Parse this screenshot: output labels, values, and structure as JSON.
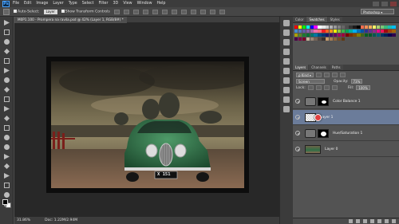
{
  "app": {
    "logo": "Ps"
  },
  "menu": [
    "File",
    "Edit",
    "Image",
    "Layer",
    "Type",
    "Select",
    "Filter",
    "3D",
    "View",
    "Window",
    "Help"
  ],
  "options_bar": {
    "auto_select_label": "Auto-Select:",
    "auto_select_value": "Layer",
    "show_transform_label": "Show Transform Controls",
    "workspace": "Photoshop ▾"
  },
  "document": {
    "tab_title": "M0P1.100 - Prompera na ravila.psd @ 42% (Layer 1, RGB/8#) *",
    "zoom": "31.86%",
    "doc_size": "Doc: 1.22M/2.94M",
    "plate_text": "X 151"
  },
  "panels": {
    "swatch_tabs": [
      "Color",
      "Swatches",
      "Styles"
    ],
    "layer_tabs": [
      "Layers",
      "Channels",
      "Paths"
    ],
    "blend_mode": "Screen",
    "opacity_label": "Opacity:",
    "opacity_value": "73%",
    "lock_label": "Lock:",
    "fill_label": "Fill:",
    "fill_value": "100%",
    "layers": [
      {
        "name": "Color Balance 1",
        "selected": false
      },
      {
        "name": "Layer 1",
        "selected": true
      },
      {
        "name": "Hue/Saturation 1",
        "selected": false
      },
      {
        "name": "Layer 0",
        "selected": false
      }
    ]
  },
  "colors": {
    "ui_dark": "#3c3c3c",
    "panel": "#535353",
    "selection": "#6b7c9a",
    "car_green": "#2f6e46",
    "ps_blue": "#4aa3ff"
  },
  "swatches": [
    "#ff0000",
    "#ffff00",
    "#00ff00",
    "#00ffff",
    "#0000ff",
    "#ff00ff",
    "#ffffff",
    "#e6e6e6",
    "#cccccc",
    "#b3b3b3",
    "#999999",
    "#808080",
    "#666666",
    "#4d4d4d",
    "#333333",
    "#1a1a1a",
    "#000000",
    "#f26c4f",
    "#f68e55",
    "#fbaf5c",
    "#fff467",
    "#acd372",
    "#7cc576",
    "#3bb878",
    "#1abbb4",
    "#00bff3",
    "#438ccb",
    "#5574b9",
    "#605ca8",
    "#855fa8",
    "#a763a8",
    "#f06ea9",
    "#f26d7d",
    "#ed1c24",
    "#f26522",
    "#f7941d",
    "#fff200",
    "#8dc73f",
    "#39b54a",
    "#00a651",
    "#00a99d",
    "#00aeef",
    "#0072bc",
    "#0054a6",
    "#2e3192",
    "#662d91",
    "#92278f",
    "#ec008c",
    "#ed145b",
    "#9e0b0f",
    "#a0410d",
    "#a3620a",
    "#aba000",
    "#598527",
    "#1a7b30",
    "#007236",
    "#00746b",
    "#0076a3",
    "#004b80",
    "#003471",
    "#1b1464",
    "#440e62",
    "#630460",
    "#9e005d",
    "#9e0039",
    "#790000",
    "#7b2e00",
    "#7d4900",
    "#827b00",
    "#406618",
    "#005e20",
    "#005826",
    "#005952",
    "#005b7f",
    "#003663",
    "#002157",
    "#0d004c",
    "#32004b",
    "#4b0049",
    "#7b0046",
    "#7a0026",
    "#c7b299",
    "#998675",
    "#736357",
    "#534741",
    "#37302d",
    "#c69c6d",
    "#a67c52",
    "#8c6239",
    "#754c24",
    "#603913"
  ]
}
